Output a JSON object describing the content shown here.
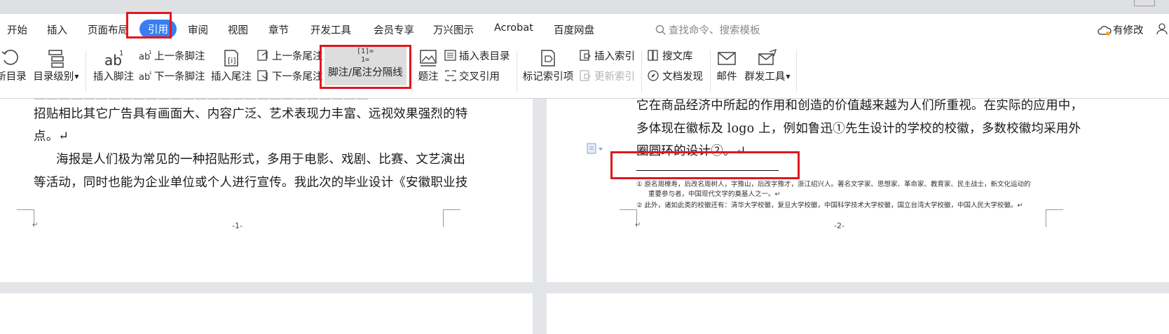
{
  "menu": {
    "tabs": [
      "开始",
      "插入",
      "页面布局",
      "引用",
      "审阅",
      "视图",
      "章节",
      "开发工具",
      "会员专享",
      "万兴图示",
      "Acrobat",
      "百度网盘"
    ],
    "active": "引用",
    "search_placeholder": "查找命令、搜索模板",
    "status": "有修改"
  },
  "ribbon": {
    "update_toc": "新目录",
    "toc_level": "目录级别",
    "insert_footnote": "插入脚注",
    "prev_footnote": "上一条脚注",
    "next_footnote": "下一条脚注",
    "insert_endnote": "插入尾注",
    "prev_endnote": "上一条尾注",
    "next_endnote": "下一条尾注",
    "separator": "脚注/尾注分隔线",
    "caption": "题注",
    "insert_tof": "插入表目录",
    "cross_ref": "交叉引用",
    "mark_index": "标记索引项",
    "insert_index": "插入索引",
    "update_index": "更新索引",
    "search_lib": "搜文库",
    "doc_discover": "文档发现",
    "mail": "邮件",
    "group_tools": "群发工具"
  },
  "left_page": {
    "lines": [
      "招贴相比其它广告具有画面大、内容广泛、艺术表现力丰富、远视效果强烈的特",
      "点。↵",
      "海报是人们极为常见的一种招贴形式，多用于电影、戏剧、比赛、文艺演出",
      "等活动，同时也能为企业单位或个人进行宣传。我此次的毕业设计《安徽职业技"
    ],
    "para_mark": "↵",
    "page_number": "-1-"
  },
  "right_page": {
    "lines": [
      "它在商品经济中所起的作用和创造的价值越来越为人们所重视。在实际的应用中，",
      "多体现在徽标及 logo 上，例如鲁迅①先生设计的学校的校徽，多数校徽均采用外",
      "圈圆环的设计②。↵"
    ],
    "footnotes": [
      "① 原名周樟寿，后改名周树人，字豫山，后改字豫才，浙江绍兴人。著名文学家、思想家、革命家、教育家、民主战士，新文化运动的",
      "重要参与者，中国现代文学的奠基人之一。↵",
      "② 此外，诸如此类的校徽还有：清华大学校徽，复旦大学校徽，中国科学技术大学校徽，国立台湾大学校徽，中国人民大学校徽。↵"
    ],
    "para_mark": "↵",
    "page_number": "-2-"
  }
}
